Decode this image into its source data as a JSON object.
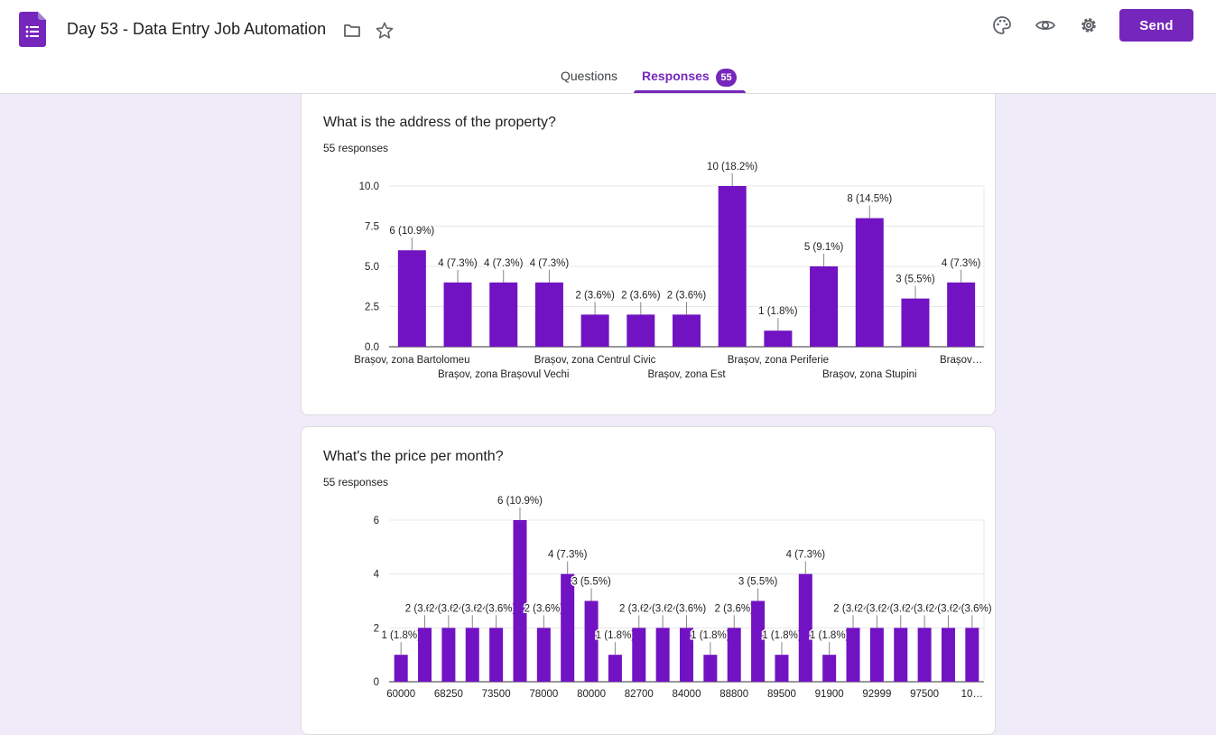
{
  "header": {
    "doc_title": "Day 53 - Data Entry Job Automation",
    "send_label": "Send",
    "icons": [
      "forms-app-icon",
      "folder-icon",
      "star-icon",
      "palette-icon",
      "eye-icon",
      "gear-icon"
    ]
  },
  "tabs": {
    "questions": "Questions",
    "responses": "Responses",
    "responses_count": "55"
  },
  "colors": {
    "accent": "#7627bb",
    "bar": "#7113c2",
    "page_bg": "#f0ebf8"
  },
  "questions": [
    {
      "title": "What is the address of the property?",
      "count_text": "55 responses"
    },
    {
      "title": "What's the price per month?",
      "count_text": "55 responses"
    }
  ],
  "chart_data": [
    {
      "type": "bar",
      "ylim": [
        0,
        10
      ],
      "yticks": [
        "0.0",
        "2.5",
        "5.0",
        "7.5",
        "10.0"
      ],
      "values": [
        6,
        4,
        4,
        4,
        2,
        2,
        2,
        10,
        1,
        5,
        8,
        3,
        4
      ],
      "labels": [
        "6 (10.9%)",
        "4 (7.3%)",
        "4 (7.3%)",
        "4 (7.3%)",
        "2 (3.6%)",
        "2 (3.6%)",
        "2 (3.6%)",
        "10 (18.2%)",
        "1 (1.8%)",
        "5 (9.1%)",
        "8 (14.5%)",
        "3 (5.5%)",
        "4 (7.3%)"
      ],
      "xtick_labels": [
        {
          "index": 0,
          "text": "Brașov, zona Bartolomeu",
          "row": 0
        },
        {
          "index": 2,
          "text": "Brașov, zona Brașovul Vechi",
          "row": 1
        },
        {
          "index": 4,
          "text": "Brașov, zona Centrul Civic",
          "row": 0
        },
        {
          "index": 6,
          "text": "Brașov, zona Est",
          "row": 1
        },
        {
          "index": 8,
          "text": "Brașov, zona Periferie",
          "row": 0
        },
        {
          "index": 10,
          "text": "Brașov, zona Stupini",
          "row": 1
        },
        {
          "index": 12,
          "text": "Brașov…",
          "row": 0
        }
      ]
    },
    {
      "type": "bar",
      "ylim": [
        0,
        6
      ],
      "yticks": [
        "0",
        "2",
        "4",
        "6"
      ],
      "values": [
        1,
        2,
        2,
        2,
        2,
        6,
        2,
        4,
        3,
        1,
        2,
        2,
        2,
        1,
        2,
        3,
        1,
        4,
        1,
        2,
        2,
        2,
        2,
        2,
        2
      ],
      "labels": [
        "1 (1.8%)",
        "2 (3.6%)",
        "2 (3.6%)",
        "2 (3.6%)",
        "2 (3.6%)",
        "6 (10.9%)",
        "2 (3.6%)",
        "4 (7.3%)",
        "3 (5.5%)",
        "1 (1.8%)",
        "2 (3.6%)",
        "2 (3.6%)",
        "2 (3.6%)",
        "1 (1.8%)",
        "2 (3.6%)",
        "3 (5.5%)",
        "1 (1.8%)",
        "4 (7.3%)",
        "1 (1.8%)",
        "2 (3.6%)",
        "2 (3.6%)",
        "2 (3.6%)",
        "2 (3.6%)",
        "2 (3.6%)",
        "2 (3.6%)"
      ],
      "xtick_labels": [
        {
          "index": 0,
          "text": "60000",
          "row": 0
        },
        {
          "index": 2,
          "text": "68250",
          "row": 0
        },
        {
          "index": 4,
          "text": "73500",
          "row": 0
        },
        {
          "index": 6,
          "text": "78000",
          "row": 0
        },
        {
          "index": 8,
          "text": "80000",
          "row": 0
        },
        {
          "index": 10,
          "text": "82700",
          "row": 0
        },
        {
          "index": 12,
          "text": "84000",
          "row": 0
        },
        {
          "index": 14,
          "text": "88800",
          "row": 0
        },
        {
          "index": 16,
          "text": "89500",
          "row": 0
        },
        {
          "index": 18,
          "text": "91900",
          "row": 0
        },
        {
          "index": 20,
          "text": "92999",
          "row": 0
        },
        {
          "index": 22,
          "text": "97500",
          "row": 0
        },
        {
          "index": 24,
          "text": "10…",
          "row": 0
        }
      ]
    }
  ]
}
